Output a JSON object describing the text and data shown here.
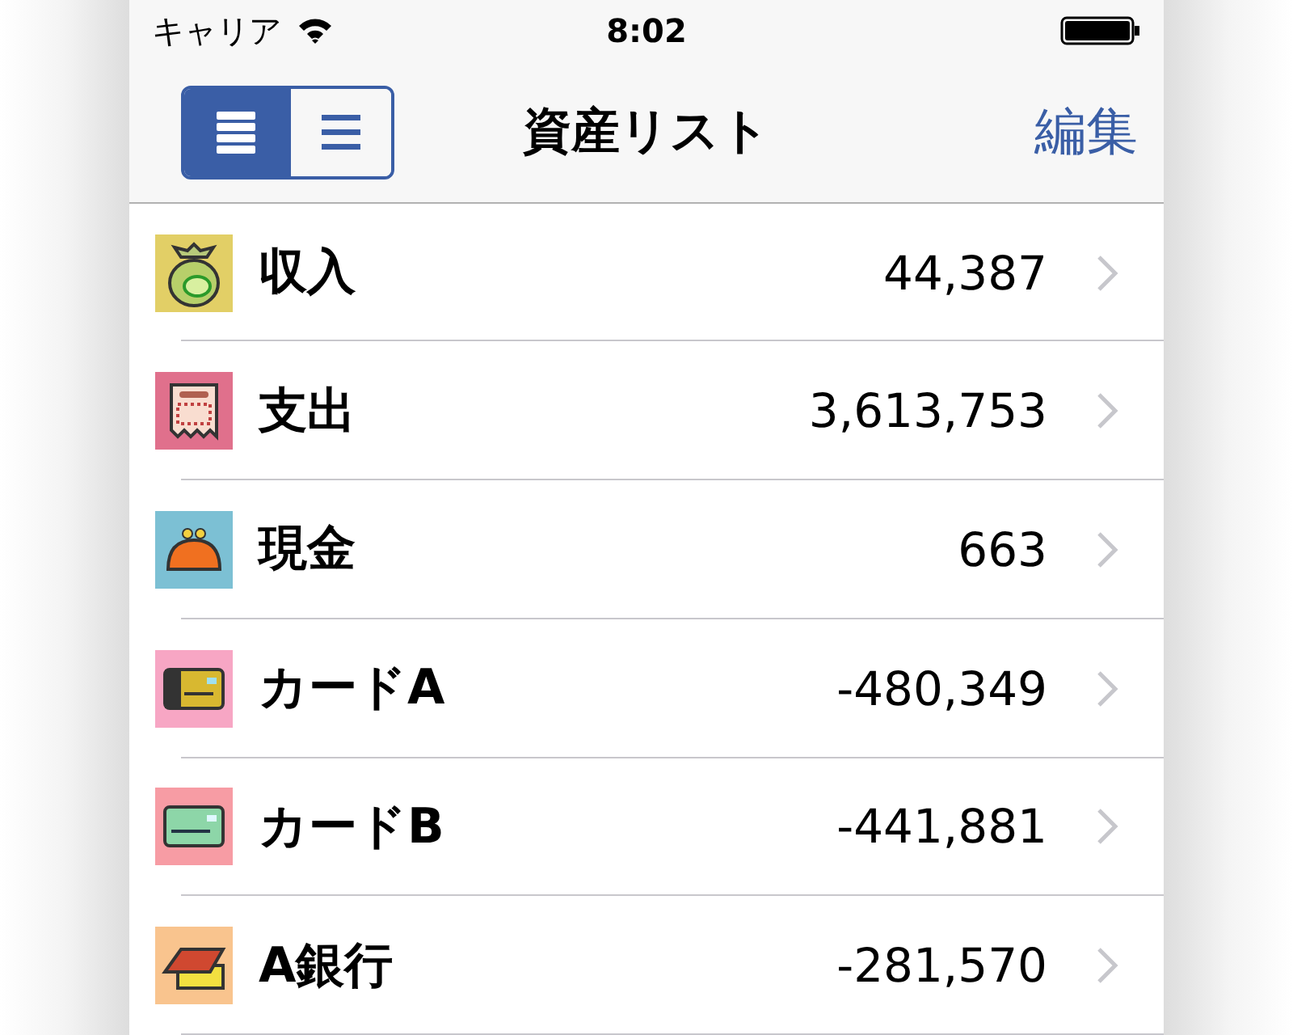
{
  "status_bar": {
    "carrier": "キャリア",
    "time": "8:02"
  },
  "nav": {
    "title": "資産リスト",
    "edit": "編集",
    "view_modes": [
      {
        "kind": "thick",
        "selected": true
      },
      {
        "kind": "thin",
        "selected": false
      }
    ]
  },
  "rows": [
    {
      "name": "収入",
      "amount": "44,387",
      "kind": "bag",
      "color": "#e2cf66"
    },
    {
      "name": "支出",
      "amount": "3,613,753",
      "kind": "receipt",
      "color": "#e0708c"
    },
    {
      "name": "現金",
      "amount": "663",
      "kind": "purse",
      "color": "#7cc0d4"
    },
    {
      "name": "カードA",
      "amount": "-480,349",
      "kind": "chip-card",
      "color": "#f7a6c4"
    },
    {
      "name": "カードB",
      "amount": "-441,881",
      "kind": "card",
      "color": "#f79ca4"
    },
    {
      "name": "A銀行",
      "amount": "-281,570",
      "kind": "bankbook",
      "color": "#f9c48e"
    }
  ]
}
